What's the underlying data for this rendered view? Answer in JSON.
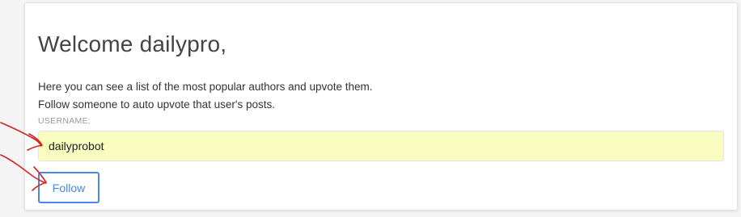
{
  "welcome": {
    "title": "Welcome dailypro,"
  },
  "intro": {
    "line1": "Here you can see a list of the most popular authors and upvote them.",
    "line2": "Follow someone to auto upvote that user's posts."
  },
  "form": {
    "username_label": "USERNAME:",
    "username_value": "dailyprobot",
    "follow_label": "Follow"
  },
  "colors": {
    "accent": "#4a86e8",
    "input_bg": "#fafdc0",
    "annotation": "#d62020"
  }
}
